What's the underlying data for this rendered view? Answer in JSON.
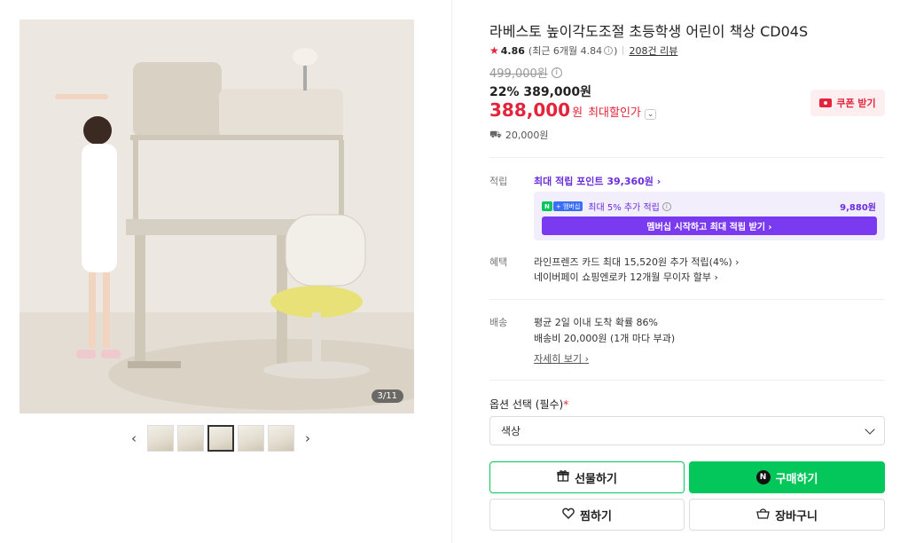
{
  "gallery": {
    "counter": "3/11",
    "thumbnail_count": 5,
    "active_thumbnail": 3
  },
  "product": {
    "title": "라베스토 높이각도조절 초등학생 어린이 책상 CD04S",
    "rating": "4.86",
    "rating_recent": "(최근 6개월 4.84",
    "rating_recent_close": ")",
    "reviews": "208건 리뷰",
    "original_price": "499,000원",
    "discount_rate": "22%",
    "sale_price": "389,000원",
    "max_discount_price": "388,000",
    "max_discount_unit": "원",
    "max_discount_label": "최대할인가",
    "coupon_label": "쿠폰 받기",
    "shipping_fee": "20,000원"
  },
  "points": {
    "label": "적립",
    "max_points": "최대 적립 포인트 39,360원 ›",
    "membership_badge": "N",
    "membership_badge_plus": "+ 멤버십",
    "membership_text": "최대 5% 추가 적립",
    "membership_amount": "9,880원",
    "membership_button": "멤버십 시작하고 최대 적립 받기 ›"
  },
  "benefits": {
    "label": "혜택",
    "line1": "라인프렌즈 카드 최대 15,520원 추가 적립(4%) ›",
    "line2": "네이버페이 쇼핑엔로카 12개월 무이자 할부 ›"
  },
  "delivery": {
    "label": "배송",
    "line1": "평균 2일 이내 도착 확률 86%",
    "line2": "배송비 20,000원 (1개 마다 부과)",
    "details": "자세히 보기 ›"
  },
  "options": {
    "label": "옵션 선택 (필수)",
    "required_mark": "*",
    "select_value": "색상"
  },
  "buttons": {
    "gift": "선물하기",
    "buy": "구매하기",
    "wish": "찜하기",
    "cart": "장바구니"
  },
  "colors": {
    "accent_red": "#e4243b",
    "naver_green": "#03c75a",
    "membership_purple": "#7a3bf0"
  }
}
